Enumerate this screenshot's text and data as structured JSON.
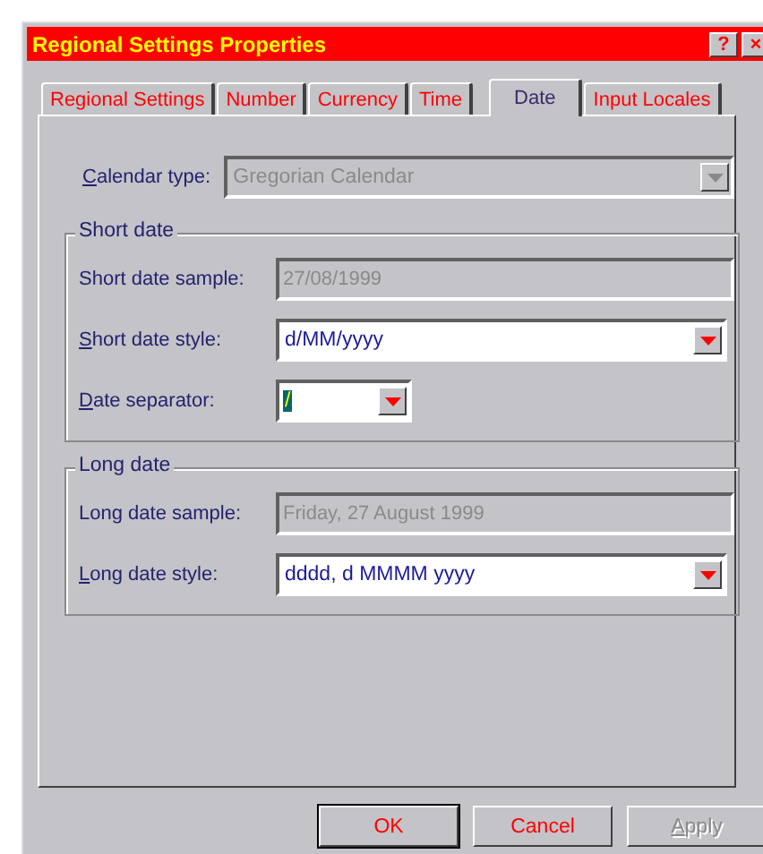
{
  "window": {
    "title": "Regional Settings Properties",
    "title_buttons": [
      "?",
      "×"
    ]
  },
  "tabs": [
    {
      "label": "Regional Settings",
      "selected": false
    },
    {
      "label": "Number",
      "selected": false
    },
    {
      "label": "Currency",
      "selected": false
    },
    {
      "label": "Time",
      "selected": false
    },
    {
      "label": "Date",
      "selected": true
    },
    {
      "label": "Input Locales",
      "selected": false
    }
  ],
  "calendar": {
    "label": "Calendar type:",
    "mnemonic": true,
    "value": "Gregorian Calendar",
    "disabled": true
  },
  "groups": [
    {
      "title": "Short date",
      "rows": [
        {
          "kind": "sample",
          "label": "Short date sample:",
          "mnemonic": false,
          "value": "27/08/1999"
        },
        {
          "kind": "combo",
          "label": "Short date style:",
          "mnemonic": true,
          "value": "d/MM/yyyy",
          "selected": false
        },
        {
          "kind": "small-combo",
          "label": "Date separator:",
          "mnemonic": true,
          "value": "/",
          "selected": true
        }
      ]
    },
    {
      "title": "Long date",
      "rows": [
        {
          "kind": "sample",
          "label": "Long date sample:",
          "mnemonic": false,
          "value": "Friday, 27 August 1999"
        },
        {
          "kind": "combo",
          "label": "Long date style:",
          "mnemonic": true,
          "value": "dddd, d MMMM yyyy",
          "selected": false
        }
      ]
    }
  ],
  "buttons": [
    {
      "label": "OK",
      "default": true,
      "disabled": false,
      "mnemonic": false
    },
    {
      "label": "Cancel",
      "default": false,
      "disabled": false,
      "mnemonic": false
    },
    {
      "label": "Apply",
      "default": false,
      "disabled": true,
      "mnemonic": true
    }
  ]
}
